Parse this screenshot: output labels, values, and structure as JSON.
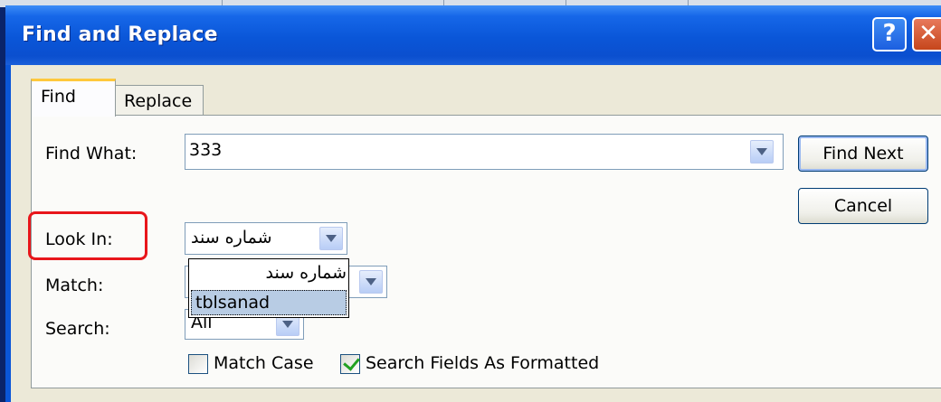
{
  "window": {
    "title": "Find and Replace",
    "help_glyph": "?",
    "close_glyph": "✕"
  },
  "tabs": [
    {
      "label": "Find",
      "active": true
    },
    {
      "label": "Replace",
      "active": false
    }
  ],
  "form": {
    "find_what": {
      "label": "Find What:",
      "value": "333"
    },
    "look_in": {
      "label": "Look In:",
      "value": "شماره سند"
    },
    "match": {
      "label": "Match:"
    },
    "search": {
      "label": "Search:",
      "value": "All"
    }
  },
  "dropdown_list": {
    "items": [
      {
        "label": "شماره سند",
        "selected": false
      },
      {
        "label": "tblsanad",
        "selected": true
      }
    ]
  },
  "buttons": {
    "find_next": "Find Next",
    "cancel": "Cancel"
  },
  "checkboxes": [
    {
      "label": "Match Case",
      "checked": false
    },
    {
      "label": "Search Fields As Formatted",
      "checked": true
    }
  ],
  "colors": {
    "titlebar": "#0a56d8",
    "highlight": "#e8161b",
    "selection": "#b8cce4",
    "check": "#21a121"
  }
}
